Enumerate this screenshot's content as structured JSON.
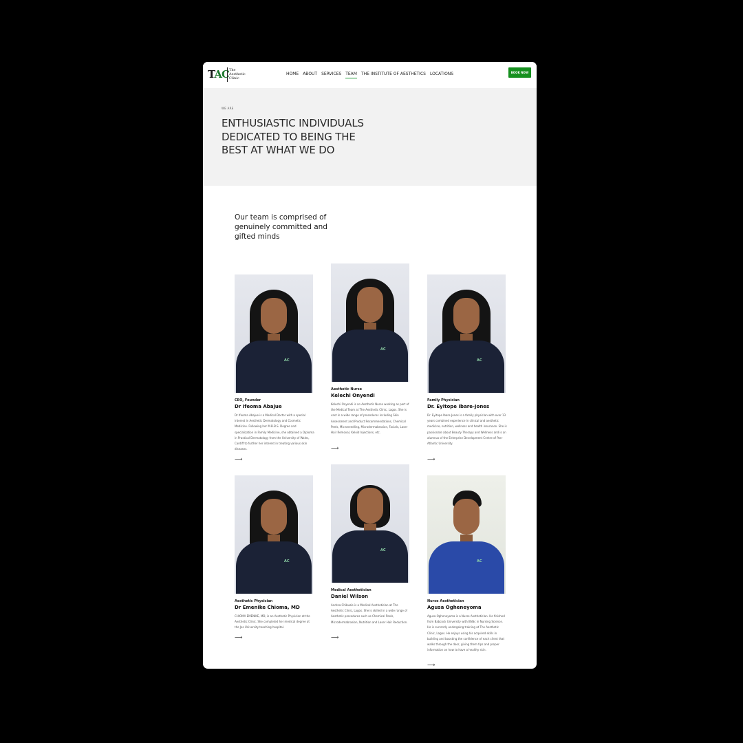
{
  "brand": {
    "mark_t": "T",
    "mark_ac": "AC",
    "name": "The Aesthetic Clinic"
  },
  "nav": {
    "items": [
      {
        "label": "HOME",
        "active": false
      },
      {
        "label": "ABOUT",
        "active": false
      },
      {
        "label": "SERVICES",
        "active": false
      },
      {
        "label": "TEAM",
        "active": true
      },
      {
        "label": "THE INSTITUTE OF AESTHETICS",
        "active": false
      },
      {
        "label": "LOCATIONS",
        "active": false
      }
    ],
    "cta": "BOOK NOW",
    "accent_color": "#16901f"
  },
  "hero": {
    "eyebrow": "WE ARE",
    "title": "ENTHUSIASTIC INDIVIDUALS DEDICATED TO BEING THE BEST AT WHAT WE DO"
  },
  "intro": "Our team is comprised of genuinely committed and gifted minds",
  "team": [
    {
      "role": "CEO, Founder",
      "name": "Dr Ifeoma Abajue",
      "bio": "Dr Ifeoma Abajue is a Medical Doctor with a special interest in Aesthetic Dermatology and Cosmetic Medicine. Following her M.B.B.S. Degree and specialization in Family Medicine, she obtained a Diploma in Practical Dermatology from the University of Wales, Cardiff to further her interest in treating various skin diseases.",
      "arrow": "⟶"
    },
    {
      "role": "Aesthetic Nurse",
      "name": "Kelechi Onyendi",
      "bio": "Kelechi Onyendi is an Aesthetic Nurse working as part of the Medical Team at The Aesthetic Clinic, Lagos. She is vast in a wide range of procedures including Skin Assessment and Product Recommendations, Chemical Peels, Microneedling, Microdermabrasion, Facials, Laser Hair Removal, Keloid Injections, etc.",
      "arrow": "⟶"
    },
    {
      "role": "Family Physician",
      "name": "Dr. Eyitope Ibare-Jones",
      "bio": "Dr. Eyitope Ibare-Jones is a family physician with over 13 years combined experience in clinical and aesthetic medicine, nutrition, wellness and health insurance. She is passionate about Beauty Therapy and Wellness and is an alumnus of the Enterprise Development Centre of Pan-Atlantic University.",
      "arrow": "⟶"
    },
    {
      "role": "Aesthetic Physician",
      "name": "Dr Emenike Chioma, MD",
      "bio": "CHIOMA EMENIKE, MD, is an Aesthetic Physician at the Aesthetic Clinic. She completed her medical degree at the Jos University teaching hospital.",
      "arrow": "⟶"
    },
    {
      "role": "Medical Aesthetician",
      "name": "Daniel Wilson",
      "bio": "Andrea Chibuzie is a Medical Aesthetician at The Aesthetic Clinic, Lagos. She is skilled in a wide range of Aesthetic procedures such as Chemical Peels, Microdermabrasion, Nutrition and Laser Hair Reduction.",
      "arrow": "⟶"
    },
    {
      "role": "Nurse Aesthetician",
      "name": "Agusa Ogheneyoma",
      "bio": "Agusa Ogheneyoma is a Nurse Aesthetician. He finished from Babcock University with BNSc in Nursing Science. He is currently undergoing training at The Aesthetic Clinic, Lagos. He enjoys using his acquired skills in building and boosting the confidence of each client that walks through the door, giving them tips and proper information on how to have a healthy skin.",
      "arrow": "⟶"
    }
  ]
}
